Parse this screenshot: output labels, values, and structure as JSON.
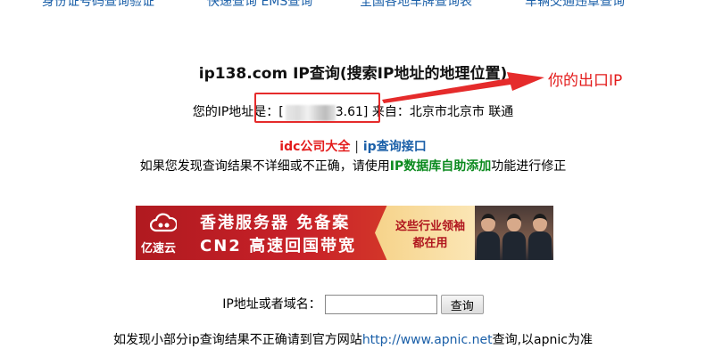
{
  "top_nav": [
    {
      "label": "身份证号码查询验证"
    },
    {
      "label": "快递查询 EMS查询"
    },
    {
      "label": "全国各地车牌查询表"
    },
    {
      "label": "车辆交通违章查询"
    }
  ],
  "header": {
    "title": "ip138.com IP查询(搜索IP地址的地理位置)"
  },
  "annotation": {
    "text": "你的出口IP",
    "color": "#e31b1b"
  },
  "ip_result": {
    "prefix": "您的IP地址是：[",
    "ip_visible": "3.61",
    "suffix": "] 来自：北京市北京市 联通"
  },
  "quick_links": {
    "idc_label": "idc公司大全",
    "separator": "|",
    "api_label": "ip查询接口"
  },
  "notice": {
    "before": "如果您发现查询结果不详细或不正确，请使用",
    "link": "IP数据库自助添加",
    "after": "功能进行修正"
  },
  "ad_banner": {
    "brand": "亿速云",
    "line1": "香港服务器 免备案",
    "line2": "CN2 高速回国带宽",
    "ribbon_line1": "这些行业领袖",
    "ribbon_line2": "都在用",
    "colors": {
      "bg": "#c82128",
      "ribbon": "#f6d38a",
      "ribbon_text": "#b0161e"
    }
  },
  "search_form": {
    "label": "IP地址或者域名：",
    "input_value": "",
    "button_label": "查询"
  },
  "footer": {
    "before": "如发现小部分ip查询结果不正确请到官方网站",
    "url": "http://www.apnic.net",
    "after": "查询,以apnic为准"
  }
}
